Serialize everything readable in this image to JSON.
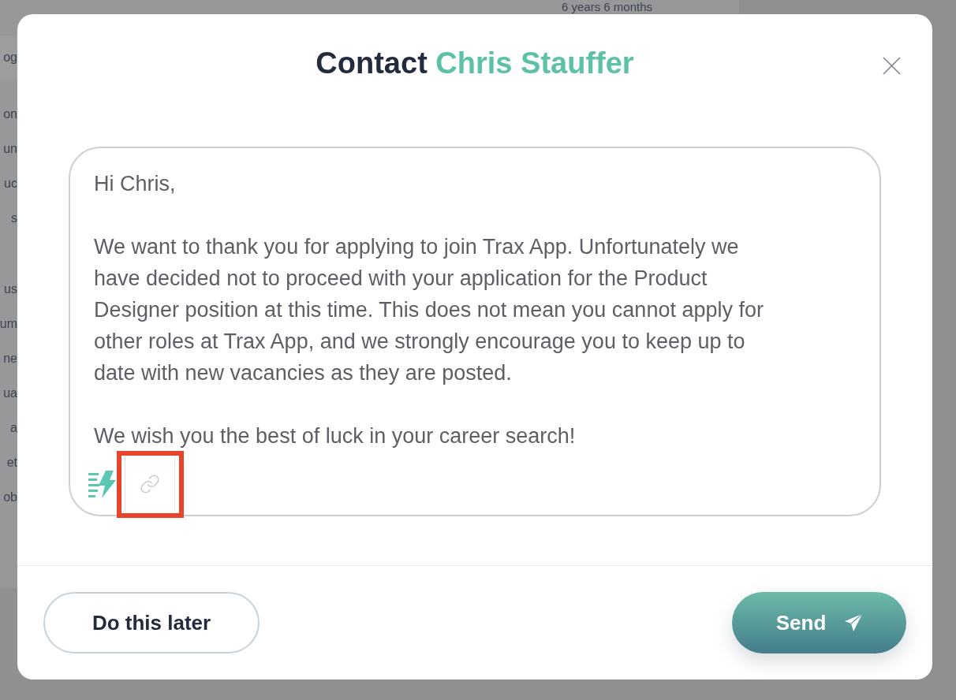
{
  "background": {
    "top_text": "6 years 6 months",
    "heading_fragment": "og",
    "fragment_groups": [
      {
        "lines": [
          "on",
          "un",
          "uc",
          "s"
        ]
      },
      {
        "lines": [
          "us",
          "um",
          "ne",
          "ua",
          "a",
          "et",
          "ob"
        ]
      }
    ]
  },
  "dialog": {
    "title_parts": [
      {
        "text": "Contact",
        "accent": false
      },
      {
        "text": "Chris Stauffer",
        "accent": true
      }
    ],
    "message": {
      "paragraphs": [
        "Hi Chris,",
        "We want to thank you for applying to join Trax App. Unfortunately we\nhave decided not to proceed with your application for the Product\nDesigner position at this time. This does not mean you cannot apply for\nother roles at Trax App, and we strongly encourage you to keep up to\ndate with new vacancies as they are posted.",
        "We wish you the best of luck in your career search!"
      ]
    },
    "tools": [
      {
        "kind": "snippets",
        "highlighted": false
      },
      {
        "kind": "link",
        "highlighted": true
      }
    ],
    "buttons": [
      {
        "kind": "secondary",
        "label": "Do this later"
      },
      {
        "kind": "primary",
        "label": "Send"
      }
    ]
  }
}
